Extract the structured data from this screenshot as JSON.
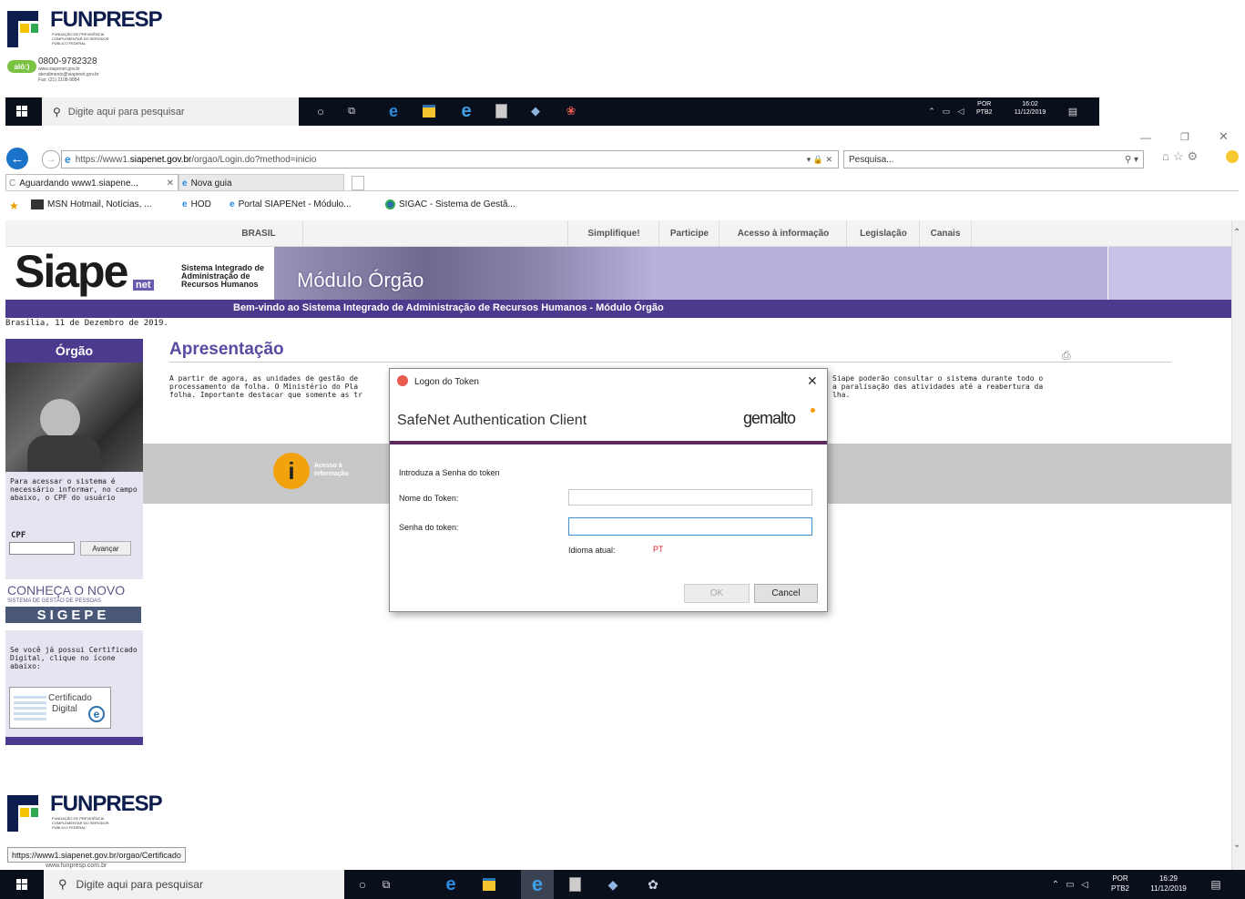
{
  "top_logo": {
    "name": "FUNPRESP",
    "tagline": "FUNDAÇÃO DE PREVIDÊNCIA COMPLEMENTAR DO SERVIDOR PÚBLICO FEDERAL"
  },
  "contact": {
    "badge": "alô:)",
    "phone": "0800-9782328",
    "site": "www.siapenet.gov.br",
    "email": "atendimento@siapenet.gov.br",
    "fax": "Fax: (21) 2108-9884"
  },
  "taskbar_top": {
    "search_placeholder": "Digite aqui para pesquisar",
    "lang": "POR",
    "layout": "PTB2",
    "time": "16:02",
    "date": "11/12/2019"
  },
  "browser": {
    "url_base": "https://www1.",
    "url_host": "siapenet.gov.br",
    "url_path": "/orgao/Login.do?method=inicio",
    "search_placeholder": "Pesquisa...",
    "tabs": [
      {
        "label": "Aguardando www1.siapene..."
      },
      {
        "label": "Nova guia"
      }
    ],
    "favorites": [
      {
        "label": "MSN Hotmail, Notícias, ..."
      },
      {
        "label": "HOD"
      },
      {
        "label": "Portal SIAPENet - Módulo..."
      },
      {
        "label": "SIGAC - Sistema de Gestã..."
      }
    ]
  },
  "govbar": {
    "brasil": "BRASIL",
    "links": [
      "Simplifique!",
      "Participe",
      "Acesso à informação",
      "Legislação",
      "Canais"
    ]
  },
  "banner": {
    "logo": "Siape",
    "logo_net": "net",
    "system_lines": [
      "Sistema Integrado de",
      "Administração de",
      "Recursos Humanos"
    ],
    "module": "Módulo Órgão",
    "welcome": "Bem-vindo ao Sistema Integrado de Administração de Recursos Humanos - Módulo Órgão"
  },
  "date_line": "Brasília, 11 de Dezembro de 2019.",
  "left_panel": {
    "title": "Órgão",
    "instructions": "Para acessar o sistema é necessário informar, no campo abaixo, o CPF do usuário",
    "cpf_label": "CPF",
    "cpf_value": "",
    "submit_label": "Avançar",
    "promo_line1": "CONHEÇA O NOVO",
    "promo_line2": "SISTEMA DE GESTÃO DE PESSOAS",
    "promo_line3": "SIGEPE",
    "cert_text": "Se você já possui Certificado Digital, clique no ícone abaixo:",
    "cert_btn_line1": "Certificado",
    "cert_btn_line2": "Digital"
  },
  "main": {
    "heading": "Apresentação",
    "paragraph_start": "A partir de agora, as unidades de gestão de",
    "paragraph_line2": "processamento da folha. O Ministério do Pla",
    "paragraph_line3": "folha. Importante destacar que somente as tr",
    "paragraph_end1": "Siape poderão consultar o sistema durante todo o",
    "paragraph_end2": "a paralisação das atividades até a reabertura da",
    "paragraph_end3": "lha.",
    "access_label": "Acesso à Informação"
  },
  "dialog": {
    "title": "Logon do Token",
    "product": "SafeNet Authentication Client",
    "brand": "gemalto",
    "prompt": "Introduza a Senha do token",
    "token_name_label": "Nome do Token:",
    "token_name_value": "",
    "password_label": "Senha do token:",
    "password_value": "",
    "lang_label": "Idioma atual:",
    "lang_value": "PT",
    "ok_label": "OK",
    "cancel_label": "Cancel",
    "accent": "#5c2a5e",
    "lang_color": "#e0262c"
  },
  "bottom_logo": {
    "name": "FUNPRESP",
    "tagline": "FUNDAÇÃO DE PREVIDÊNCIA COMPLEMENTAR DO SERVIDOR PÚBLICO FEDERAL",
    "site": "www.funpresp.com.br"
  },
  "status_url": "https://www1.siapenet.gov.br/orgao/Certificado",
  "taskbar_bottom": {
    "search_placeholder": "Digite aqui para pesquisar",
    "lang": "POR",
    "layout": "PTB2",
    "time": "16:29",
    "date": "11/12/2019"
  },
  "colors": {
    "purple": "#4b3a8e",
    "heading": "#5b4aa1",
    "taskbar": "#0a0f1c"
  }
}
